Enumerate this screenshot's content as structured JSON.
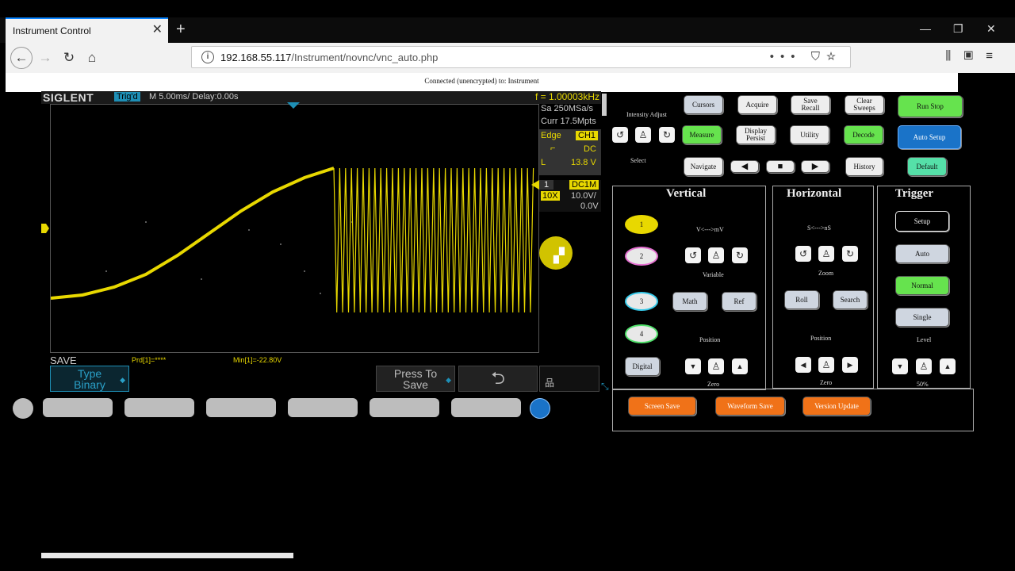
{
  "browser": {
    "tab_title": "Instrument Control",
    "url_host": "192.168.55.117",
    "url_path": "/Instrument/novnc/vnc_auto.php",
    "icons": [
      "back-icon",
      "forward-icon",
      "reload-icon",
      "home-icon",
      "info-icon",
      "page-actions-icon",
      "pocket-icon",
      "bookmark-star-icon",
      "library-icon",
      "sidebar-icon",
      "menu-icon"
    ]
  },
  "page": {
    "status": "Connected (unencrypted) to: Instrument"
  },
  "scope": {
    "brand": "SIGLENT",
    "trig_status": "Trig'd",
    "timebase": "M 5.00ms/ Delay:0.00s",
    "frequency": "f = 1.00003kHz",
    "sample_rate": "Sa 250MSa/s",
    "memory": "Curr 17.5Mpts",
    "trigger_type": "Edge",
    "trigger_source": "CH1",
    "coupling": "DC",
    "level_prefix": "L",
    "level": "13.8 V",
    "ch_number": "1",
    "ch_coupling": "DC1M",
    "probe": "10X",
    "ch_scale": "10.0V/",
    "ch_offset": "0.0V",
    "menu_name": "SAVE",
    "measure_1": "Prd[1]=****",
    "measure_2": "Min[1]=-22.80V",
    "softkey_1_line1": "Type",
    "softkey_1_line2": "Binary",
    "softkey_2_line1": "Press To",
    "softkey_2_line2": "Save",
    "colors": {
      "trace": "#e8d800",
      "accent": "#1e8fb6"
    }
  },
  "panel": {
    "intensity_label": "Intensity Adjust",
    "select_label": "Select",
    "buttons": {
      "cursors": "Cursors",
      "acquire": "Acquire",
      "save_recall_1": "Save",
      "save_recall_2": "Recall",
      "clear_sweeps_1": "Clear",
      "clear_sweeps_2": "Sweeps",
      "run_stop": "Run Stop",
      "measure": "Measure",
      "display_persist_1": "Display",
      "display_persist_2": "Persist",
      "utility": "Utility",
      "decode": "Decode",
      "auto_setup": "Auto Setup",
      "navigate": "Navigate",
      "history": "History",
      "default": "Default"
    },
    "vertical": {
      "title": "Vertical",
      "ch1": "1",
      "ch2": "2",
      "ch3": "3",
      "ch4": "4",
      "vmv": "V<--->mV",
      "variable": "Variable",
      "math": "Math",
      "ref": "Ref",
      "position": "Position",
      "digital": "Digital",
      "zero": "Zero"
    },
    "horizontal": {
      "title": "Horizontal",
      "sns": "S<--->nS",
      "zoom": "Zoom",
      "roll": "Roll",
      "search": "Search",
      "position": "Position",
      "zero": "Zero"
    },
    "trigger": {
      "title": "Trigger",
      "setup": "Setup",
      "auto": "Auto",
      "normal": "Normal",
      "single": "Single",
      "level": "Level",
      "level_value": "50%"
    },
    "bottom": {
      "screen_save": "Screen Save",
      "waveform_save": "Waveform Save",
      "version_update": "Version Update"
    }
  }
}
